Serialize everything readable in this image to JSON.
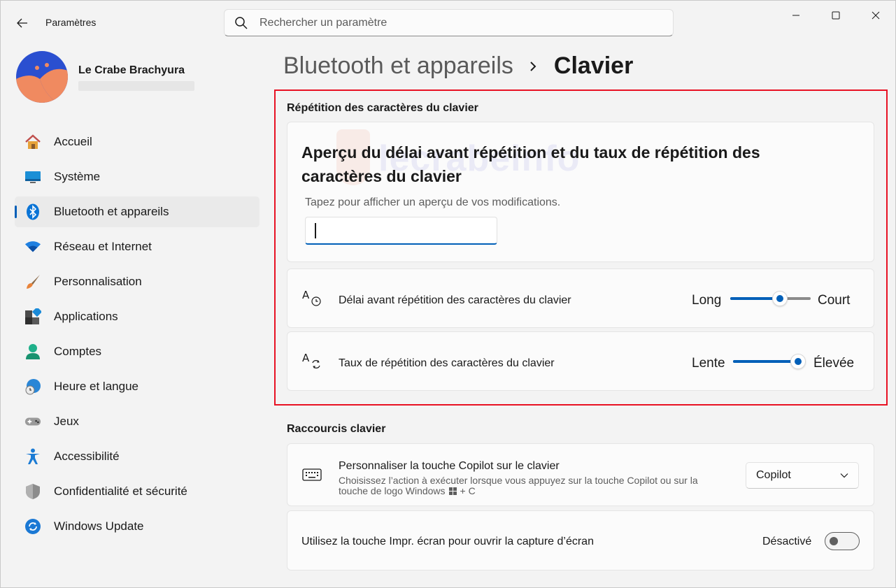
{
  "window": {
    "app_title": "Paramètres",
    "search_placeholder": "Rechercher un paramètre"
  },
  "profile": {
    "name": "Le Crabe Brachyura"
  },
  "sidebar": {
    "items": [
      {
        "label": "Accueil",
        "icon": "home-icon"
      },
      {
        "label": "Système",
        "icon": "system-icon"
      },
      {
        "label": "Bluetooth et appareils",
        "icon": "bluetooth-icon",
        "active": true
      },
      {
        "label": "Réseau et Internet",
        "icon": "wifi-icon"
      },
      {
        "label": "Personnalisation",
        "icon": "brush-icon"
      },
      {
        "label": "Applications",
        "icon": "apps-icon"
      },
      {
        "label": "Comptes",
        "icon": "account-icon"
      },
      {
        "label": "Heure et langue",
        "icon": "time-language-icon"
      },
      {
        "label": "Jeux",
        "icon": "gamepad-icon"
      },
      {
        "label": "Accessibilité",
        "icon": "accessibility-icon"
      },
      {
        "label": "Confidentialité et sécurité",
        "icon": "shield-icon"
      },
      {
        "label": "Windows Update",
        "icon": "update-icon"
      }
    ]
  },
  "breadcrumb": {
    "parent": "Bluetooth et appareils",
    "current": "Clavier"
  },
  "watermark": "lecrabeinfo",
  "repeat_section": {
    "title": "Répétition des caractères du clavier",
    "preview_heading": "Aperçu du délai avant répétition et du taux de répétition des caractères du clavier",
    "preview_hint": "Tapez pour afficher un aperçu de vos modifications.",
    "preview_value": "",
    "delay": {
      "label": "Délai avant répétition des caractères du clavier",
      "min_label": "Long",
      "max_label": "Court",
      "value": 0.62
    },
    "rate": {
      "label": "Taux de répétition des caractères du clavier",
      "min_label": "Lente",
      "max_label": "Élevée",
      "value": 1.0
    }
  },
  "shortcuts_section": {
    "title": "Raccourcis clavier",
    "copilot": {
      "label": "Personnaliser la touche Copilot sur le clavier",
      "description_line1": "Choisissez l’action à exécuter lorsque vous appuyez sur la touche Copilot ou sur la",
      "description_line2_a": "touche de logo Windows",
      "description_line2_b": "+ C",
      "selected": "Copilot"
    },
    "print_screen": {
      "label": "Utilisez la touche Impr. écran pour ouvrir la capture d’écran",
      "state": "Désactivé",
      "on": false
    }
  },
  "colors": {
    "accent": "#005fb8",
    "highlight_frame": "#e81123"
  }
}
